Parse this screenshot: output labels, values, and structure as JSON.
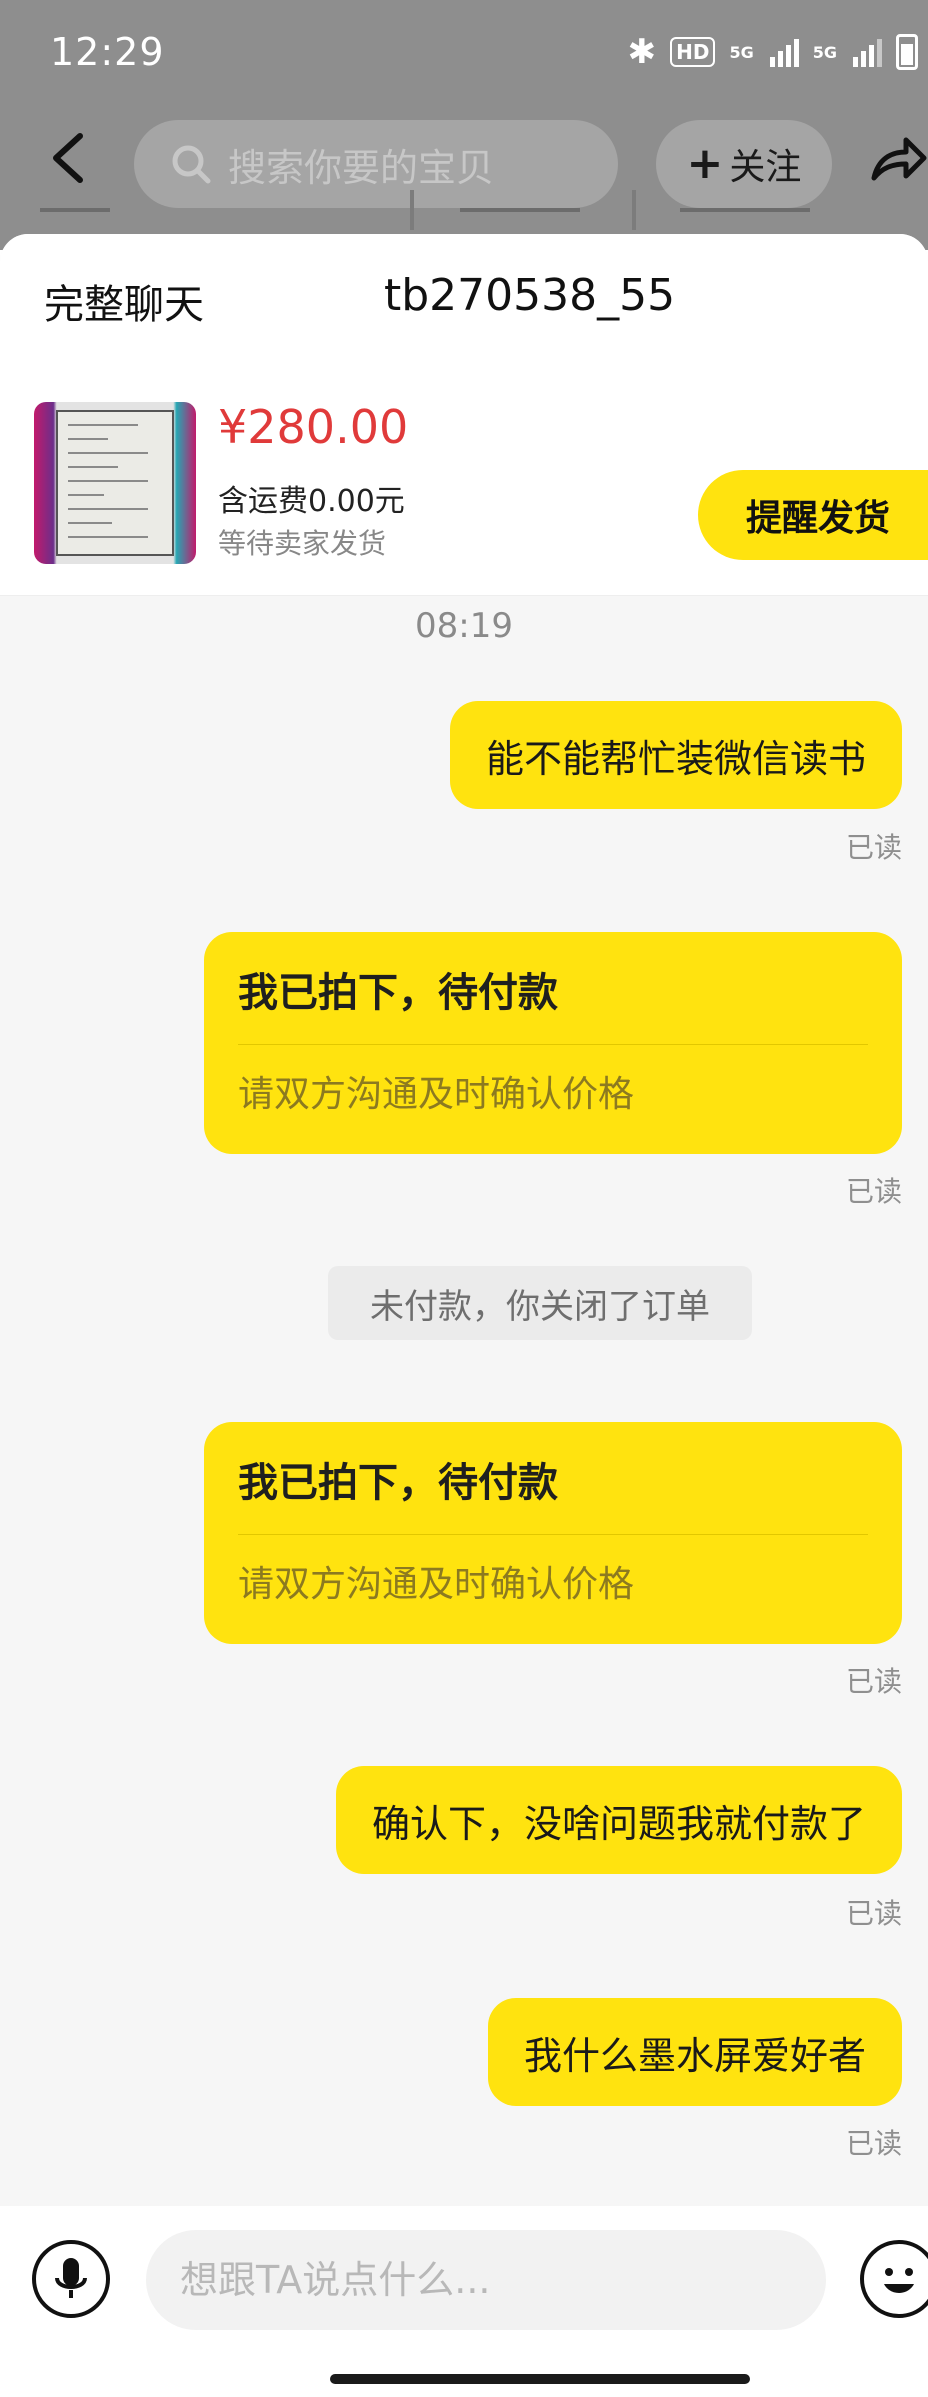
{
  "status_bar": {
    "time": "12:29",
    "hd_label": "HD",
    "network_1": "5G",
    "network_2": "5G"
  },
  "nav": {
    "search_placeholder": "搜索你要的宝贝",
    "follow_label": "关注"
  },
  "sheet": {
    "full_chat_label": "完整聊天",
    "chat_username": "tb270538_55"
  },
  "product": {
    "price": "¥280.00",
    "shipping": "含运费0.00元",
    "order_status": "等待卖家发货",
    "remind_button": "提醒发货"
  },
  "chat": {
    "timestamp": "08:19",
    "read_label": "已读",
    "messages": [
      {
        "type": "text",
        "text": "能不能帮忙装微信读书"
      },
      {
        "type": "card",
        "title": "我已拍下，待付款",
        "subtitle": "请双方沟通及时确认价格"
      },
      {
        "type": "system",
        "text": "未付款，你关闭了订单"
      },
      {
        "type": "card",
        "title": "我已拍下，待付款",
        "subtitle": "请双方沟通及时确认价格"
      },
      {
        "type": "text",
        "text": "确认下，没啥问题我就付款了"
      },
      {
        "type": "text",
        "text": "我什么墨水屏爱好者"
      }
    ]
  },
  "input": {
    "placeholder": "想跟TA说点什么..."
  },
  "icons": {
    "back": "back-arrow-icon",
    "search": "search-icon",
    "share": "share-icon",
    "mic": "microphone-icon",
    "emoji": "emoji-icon"
  },
  "colors": {
    "bubble": "#ffe30f",
    "price": "#e03a3a",
    "dim_overlay": "#8e8e8e"
  }
}
